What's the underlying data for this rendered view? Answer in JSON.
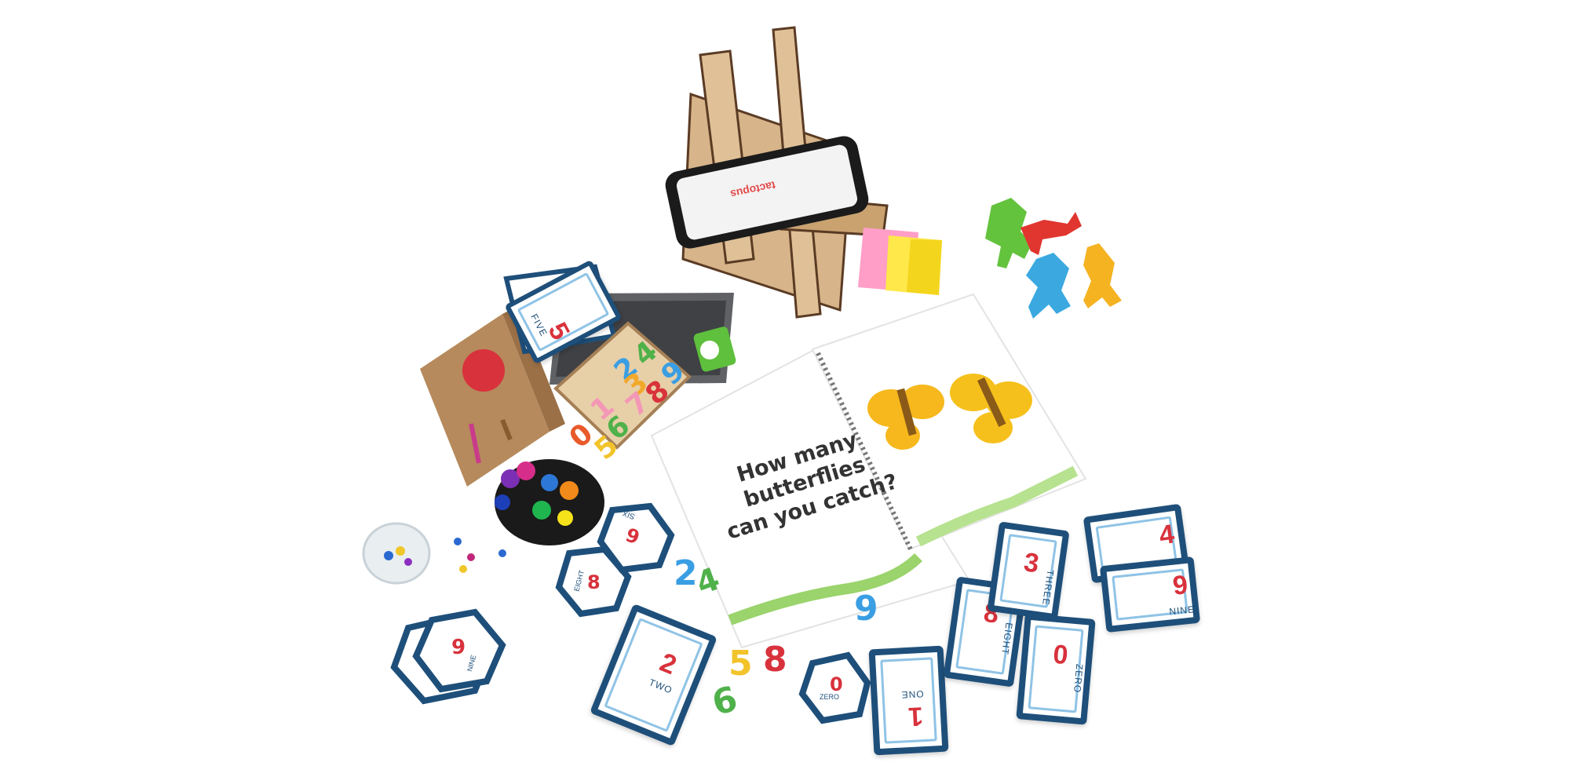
{
  "book": {
    "question_line1": "How many",
    "question_line2": "butterflies",
    "question_line3": "can you catch?"
  },
  "phone": {
    "brand": "tactopus"
  },
  "cards": {
    "five": {
      "num": "5",
      "word": "FIVE"
    },
    "six": {
      "num": "6",
      "word": "SIX"
    },
    "eight_hex": {
      "num": "8",
      "word": "EIGHT"
    },
    "nine_hex": {
      "num": "9",
      "word": "NINE"
    },
    "two": {
      "num": "2",
      "word": "TWO"
    },
    "zero_hex": {
      "num": "0",
      "word": "ZERO"
    },
    "one": {
      "num": "1",
      "word": "ONE"
    },
    "eight": {
      "num": "8",
      "word": "EIGHT"
    },
    "three": {
      "num": "3",
      "word": "THREE"
    },
    "zero": {
      "num": "0",
      "word": "ZERO"
    },
    "four": {
      "num": "4"
    },
    "nine": {
      "num": "9",
      "word": "NINE"
    }
  },
  "wooden_numbers": {
    "tray": [
      "0",
      "1",
      "2",
      "3",
      "4",
      "5",
      "6",
      "7",
      "8",
      "9"
    ],
    "loose": [
      "2",
      "4",
      "9",
      "5",
      "8",
      "6"
    ]
  },
  "colors": {
    "card_border": "#1e4f7a",
    "card_accent": "#8fc3e6",
    "card_number": "#d8323c",
    "butterfly": "#f6b81c",
    "wood": "#d9b98a"
  }
}
